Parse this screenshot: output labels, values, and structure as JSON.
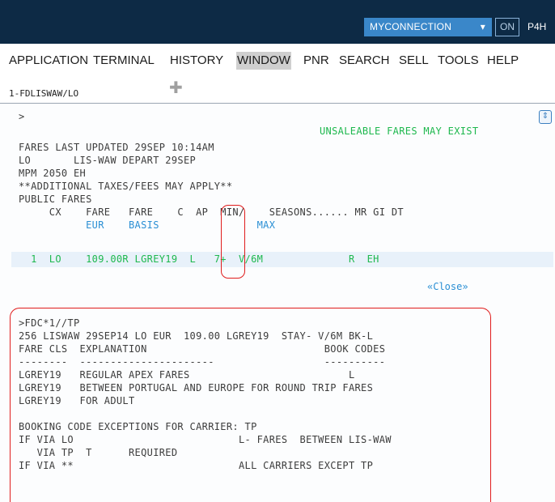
{
  "topbar": {
    "myconnection_label": "MYCONNECTION",
    "on_label": "ON",
    "user_label": "P4H"
  },
  "menu": {
    "items": [
      "APPLICATION",
      "TERMINAL",
      "HISTORY",
      "WINDOW",
      "PNR",
      "SEARCH",
      "SELL",
      "TOOLS",
      "HELP"
    ],
    "active": "WINDOW"
  },
  "tabs": {
    "active_label": "1-FDLISWAW/LO",
    "add_icon": "plus-icon"
  },
  "terminal": {
    "prompt": ">",
    "warning": "UNSALEABLE FARES MAY EXIST",
    "header_lines": [
      "FARES LAST UPDATED 29SEP 10:14AM",
      "LO       LIS-WAW DEPART 29SEP",
      "MPM 2050 EH",
      "**ADDITIONAL TAXES/FEES MAY APPLY**",
      "PUBLIC FARES",
      "     CX    FARE   FARE    C  AP  MIN/    SEASONS...... MR GI DT"
    ],
    "subheader_blue": "           EUR    BASIS                MAX",
    "fare_row": "  1  LO    109.00R LGREY19  L   7+  V/6M              R  EH",
    "close_link": "«Close»",
    "fdc_lines": [
      ">FDC*1//TP",
      "256 LISWAW 29SEP14 LO EUR  109.00 LGREY19  STAY- V/6M BK-L",
      "FARE CLS  EXPLANATION                             BOOK CODES",
      "--------  ----------------------                  ----------",
      "LGREY19   REGULAR APEX FARES                          L",
      "LGREY19   BETWEEN PORTUGAL AND EUROPE FOR ROUND TRIP FARES",
      "LGREY19   FOR ADULT",
      "",
      "BOOKING CODE EXCEPTIONS FOR CARRIER: TP",
      "IF VIA LO                           L- FARES  BETWEEN LIS-WAW",
      "   VIA TP  T      REQUIRED",
      "IF VIA **                           ALL CARRIERS EXCEPT TP"
    ]
  },
  "colors": {
    "topbar": "#0d2a45",
    "accent": "#3a87c9",
    "green_text": "#1eb84e",
    "blue_text": "#2a8fd4",
    "highlight_red": "#e01c1c"
  }
}
